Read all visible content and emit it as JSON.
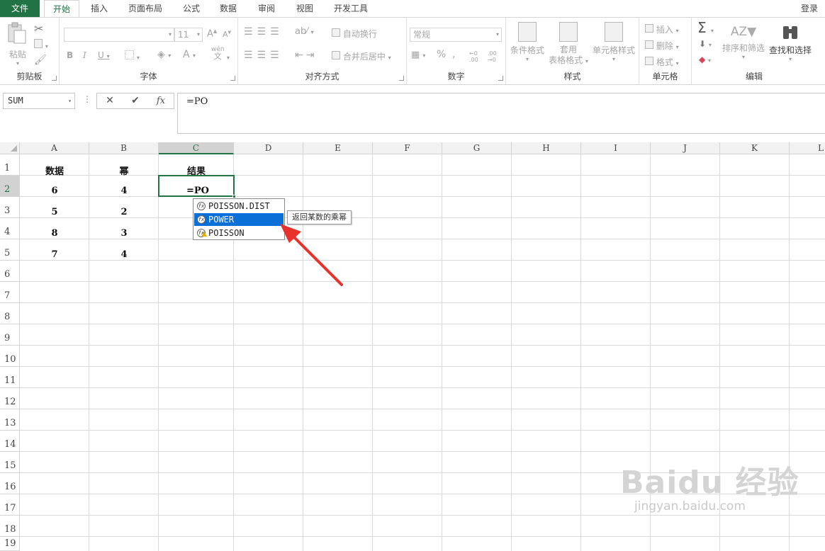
{
  "tabs": [
    "文件",
    "开始",
    "插入",
    "页面布局",
    "公式",
    "数据",
    "审阅",
    "视图",
    "开发工具"
  ],
  "active_tab": "开始",
  "login": "登录",
  "ribbon": {
    "clipboard": {
      "label": "剪贴板",
      "paste": "粘贴"
    },
    "font": {
      "label": "字体",
      "font_size": "11",
      "wen": "wén",
      "wen_char": "文"
    },
    "alignment": {
      "label": "对齐方式",
      "wrap": "自动换行",
      "merge": "合并后居中"
    },
    "number": {
      "label": "数字",
      "format": "常规"
    },
    "styles": {
      "label": "样式",
      "conditional": "条件格式",
      "table_l1": "套用",
      "table_l2": "表格格式",
      "cell_styles": "单元格样式"
    },
    "cells": {
      "label": "单元格",
      "insert": "插入",
      "delete": "删除",
      "format": "格式"
    },
    "editing": {
      "label": "编辑",
      "sort": "排序和筛选",
      "find": "查找和选择"
    }
  },
  "formula_bar": {
    "name_box": "SUM",
    "formula": "=PO"
  },
  "columns": [
    "A",
    "B",
    "C",
    "D",
    "E",
    "F",
    "G",
    "H",
    "I",
    "J",
    "K",
    "L"
  ],
  "rows": [
    "1",
    "2",
    "3",
    "4",
    "5",
    "6",
    "7",
    "8",
    "9",
    "10",
    "11",
    "12",
    "13",
    "14",
    "15",
    "16",
    "17",
    "18",
    "19"
  ],
  "cells": {
    "A1": "数据",
    "B1": "幂",
    "C1": "结果",
    "A2": "6",
    "B2": "4",
    "C2": "=PO",
    "A3": "5",
    "B3": "2",
    "A4": "8",
    "B4": "3",
    "A5": "7",
    "B5": "4"
  },
  "autocomplete": [
    "POISSON.DIST",
    "POWER",
    "POISSON"
  ],
  "autocomplete_selected": "POWER",
  "tooltip": "返回某数的乘幂",
  "watermark": {
    "brand": "Baidu",
    "cn": "经验",
    "url": "jingyan.baidu.com"
  },
  "colors": {
    "excel_green": "#217346",
    "selection_blue": "#0a6fd6",
    "arrow_red": "#e8322b"
  }
}
